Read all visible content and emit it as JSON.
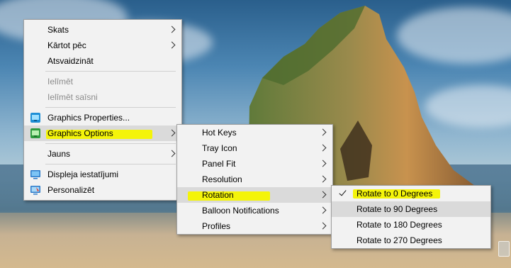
{
  "context_menu": {
    "items": [
      {
        "label": "Skats",
        "submenu": true
      },
      {
        "label": "Kārtot pēc",
        "submenu": true
      },
      {
        "label": "Atsvaidzināt"
      },
      {
        "label": "Ielīmēt",
        "disabled": true
      },
      {
        "label": "Ielīmēt saīsni",
        "disabled": true
      },
      {
        "label": "Graphics Properties...",
        "icon": "intel-graphics-icon"
      },
      {
        "label": "Graphics Options",
        "icon": "intel-graphics-icon",
        "submenu": true,
        "active": true
      },
      {
        "label": "Jauns",
        "submenu": true
      },
      {
        "label": "Displeja iestatījumi",
        "icon": "display-icon"
      },
      {
        "label": "Personalizēt",
        "icon": "personalize-icon"
      }
    ]
  },
  "graphics_options_menu": {
    "items": [
      {
        "label": "Hot Keys",
        "submenu": true
      },
      {
        "label": "Tray Icon",
        "submenu": true
      },
      {
        "label": "Panel Fit",
        "submenu": true
      },
      {
        "label": "Resolution",
        "submenu": true
      },
      {
        "label": "Rotation",
        "submenu": true,
        "active": true
      },
      {
        "label": "Balloon Notifications",
        "submenu": true
      },
      {
        "label": "Profiles",
        "submenu": true
      }
    ]
  },
  "rotation_menu": {
    "items": [
      {
        "label": "Rotate to 0 Degrees",
        "checked": true
      },
      {
        "label": "Rotate to 90 Degrees",
        "hover": true
      },
      {
        "label": "Rotate to 180 Degrees"
      },
      {
        "label": "Rotate to 270 Degrees"
      }
    ]
  },
  "colors": {
    "highlight": "#f4f40a",
    "menu_bg": "#f2f2f2",
    "hover_bg": "#dadada"
  }
}
